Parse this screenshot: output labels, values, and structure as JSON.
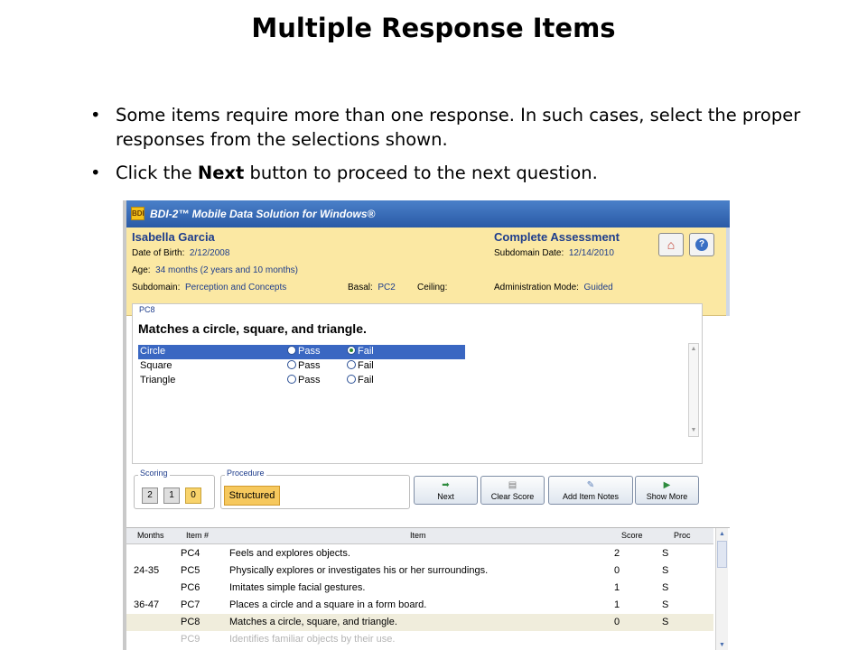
{
  "slide": {
    "title": "Multiple Response Items",
    "bullet1": "Some items require more than one response. In such cases, select the proper responses from the selections shown.",
    "bullet2_pre": "Click the ",
    "bullet2_bold": "Next",
    "bullet2_post": " button to proceed to the next question."
  },
  "window": {
    "title": "BDI-2™ Mobile Data Solution for Windows®",
    "icon_text": "BDI"
  },
  "header": {
    "child_name": "Isabella Garcia",
    "dob_label": "Date of Birth:",
    "dob_value": "2/12/2008",
    "age_label": "Age:",
    "age_value": "34 months (2 years and 10 months)",
    "subdomain_label": "Subdomain:",
    "subdomain_value": "Perception and Concepts",
    "basal_label": "Basal:",
    "basal_value": "PC2",
    "ceiling_label": "Ceiling:",
    "assessment_title": "Complete Assessment",
    "subdomain_date_label": "Subdomain Date:",
    "subdomain_date_value": "12/14/2010",
    "admin_mode_label": "Administration Mode:",
    "admin_mode_value": "Guided",
    "home_icon": "home-icon",
    "help_icon": "help-icon"
  },
  "item": {
    "code": "PC8",
    "question": "Matches a circle, square, and triangle.",
    "pass_label": "Pass",
    "fail_label": "Fail",
    "responses": [
      {
        "label": "Circle",
        "selected_row": true,
        "answer": "Fail"
      },
      {
        "label": "Square",
        "selected_row": false,
        "answer": null
      },
      {
        "label": "Triangle",
        "selected_row": false,
        "answer": null
      }
    ]
  },
  "scoring": {
    "label": "Scoring",
    "options": [
      "2",
      "1",
      "0"
    ],
    "selected": "0"
  },
  "procedure": {
    "label": "Procedure",
    "value": "Structured"
  },
  "toolbar": {
    "next": "Next",
    "clear_score": "Clear Score",
    "add_item_notes": "Add Item Notes",
    "show_more": "Show More"
  },
  "table": {
    "headers": {
      "months": "Months",
      "item_no": "Item #",
      "item": "Item",
      "score": "Score",
      "proc": "Proc"
    },
    "rows": [
      {
        "months": "",
        "item_no": "PC4",
        "item": "Feels and explores objects.",
        "score": "2",
        "proc": "S"
      },
      {
        "months": "24-35",
        "item_no": "PC5",
        "item": "Physically explores or investigates his or her surroundings.",
        "score": "0",
        "proc": "S"
      },
      {
        "months": "",
        "item_no": "PC6",
        "item": "Imitates simple facial gestures.",
        "score": "1",
        "proc": "S"
      },
      {
        "months": "36-47",
        "item_no": "PC7",
        "item": "Places a circle and a square in a form board.",
        "score": "1",
        "proc": "S"
      },
      {
        "months": "",
        "item_no": "PC8",
        "item": "Matches a circle, square, and triangle.",
        "score": "0",
        "proc": "S"
      },
      {
        "months": "",
        "item_no": "PC9",
        "item": "Identifies familiar objects by their use.",
        "score": "",
        "proc": ""
      }
    ]
  },
  "colors": {
    "header_bg": "#fbe8a3",
    "selection": "#3a67c2",
    "accent_text": "#1e3d8c",
    "score_selected": "#f8d36b"
  }
}
